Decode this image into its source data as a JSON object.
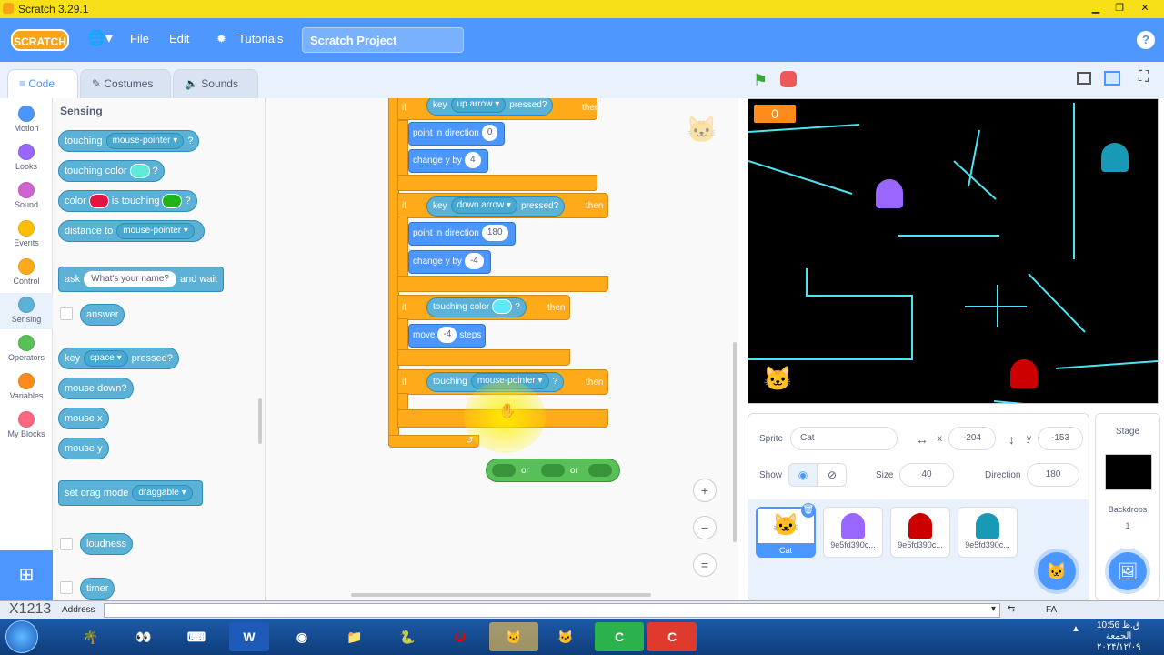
{
  "window": {
    "title": "Scratch 3.29.1"
  },
  "menubar": {
    "logo": "SCRATCH",
    "file": "File",
    "edit": "Edit",
    "tutorials": "Tutorials",
    "project_title": "Scratch Project"
  },
  "tabs": {
    "code": "Code",
    "costumes": "Costumes",
    "sounds": "Sounds"
  },
  "categories": [
    {
      "label": "Motion",
      "color": "#4c97ff"
    },
    {
      "label": "Looks",
      "color": "#9966ff"
    },
    {
      "label": "Sound",
      "color": "#cf63cf"
    },
    {
      "label": "Events",
      "color": "#ffbf00"
    },
    {
      "label": "Control",
      "color": "#ffab19"
    },
    {
      "label": "Sensing",
      "color": "#5cb1d6"
    },
    {
      "label": "Operators",
      "color": "#59c059"
    },
    {
      "label": "Variables",
      "color": "#ff8c1a"
    },
    {
      "label": "My Blocks",
      "color": "#ff6680"
    }
  ],
  "palette": {
    "heading": "Sensing",
    "touching": "touching",
    "touching_menu": "mouse-pointer",
    "q": "?",
    "touching_color": "touching color",
    "color": "color",
    "is_touching": "is touching",
    "distance_to": "distance to",
    "distance_menu": "mouse-pointer",
    "ask": "ask",
    "ask_default": "What's your name?",
    "and_wait": "and wait",
    "answer": "answer",
    "key": "key",
    "key_menu": "space",
    "pressed": "pressed?",
    "mouse_down": "mouse down?",
    "mouse_x": "mouse x",
    "mouse_y": "mouse y",
    "set_drag": "set drag mode",
    "drag_menu": "draggable",
    "loudness": "loudness",
    "timer": "timer"
  },
  "script": {
    "if": "if",
    "then": "then",
    "key": "key",
    "pressed": "pressed?",
    "up_arrow": "up arrow",
    "down_arrow": "down arrow",
    "point_dir": "point in direction",
    "dir1": "0",
    "dir2": "180",
    "change_y": "change y by",
    "dy1": "4",
    "dy2": "-4",
    "touching_color": "touching color",
    "q": "?",
    "move": "move",
    "steps_val": "-4",
    "steps": "steps",
    "touching": "touching",
    "touching_menu": "mouse-pointer",
    "or1": "or",
    "or2": "or"
  },
  "stage": {
    "score": "0"
  },
  "sprite_info": {
    "sprite_label": "Sprite",
    "sprite_name": "Cat",
    "x_label": "x",
    "x": "-204",
    "y_label": "y",
    "y": "-153",
    "show_label": "Show",
    "size_label": "Size",
    "size": "40",
    "direction_label": "Direction",
    "direction": "180"
  },
  "sprites": [
    {
      "name": "Cat",
      "color": "#ff8c1a"
    },
    {
      "name": "9e5fd390c...",
      "color": "#9966ff"
    },
    {
      "name": "9e5fd390c...",
      "color": "#cc0000"
    },
    {
      "name": "9e5fd390c...",
      "color": "#1899b5"
    }
  ],
  "stage_pane": {
    "title": "Stage",
    "backdrops_label": "Backdrops",
    "backdrops_count": "1"
  },
  "taskbar": {
    "address_label": "Address",
    "lang": "FA",
    "time": "10:56 ق.ظ",
    "day": "الجمعة",
    "date": "۲۰۲۴/۱۲/۰۹",
    "watermark": "X1213"
  }
}
